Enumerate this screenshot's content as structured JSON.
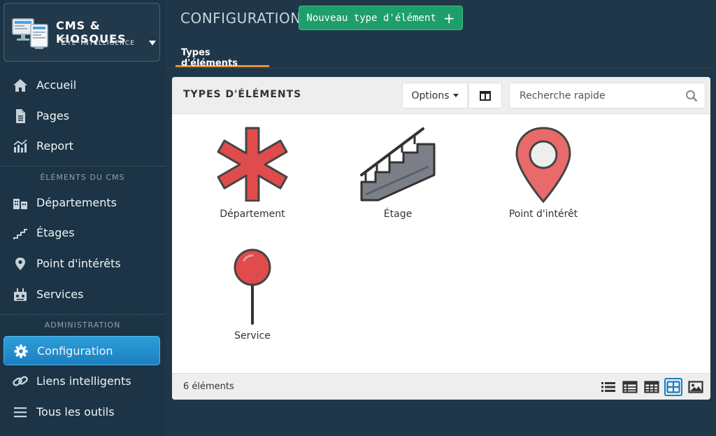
{
  "brand": {
    "title": "CMS & KIOSQUES",
    "subtitle": "Eye-Intelligence",
    "icon": "monitor-kiosk-icon"
  },
  "sidebar": {
    "items": [
      {
        "label": "Accueil",
        "icon": "home-icon"
      },
      {
        "label": "Pages",
        "icon": "file-icon"
      },
      {
        "label": "Report",
        "icon": "chart-icon"
      },
      {
        "label": "Départements",
        "icon": "departments-icon"
      },
      {
        "label": "Étages",
        "icon": "stairs-icon"
      },
      {
        "label": "Point d'intérêts",
        "icon": "map-pin-icon"
      },
      {
        "label": "Services",
        "icon": "services-icon"
      },
      {
        "label": "Configuration",
        "icon": "gear-icon",
        "active": true
      },
      {
        "label": "Liens intelligents",
        "icon": "link-icon"
      },
      {
        "label": "Tous les outils",
        "icon": "menu-icon"
      }
    ],
    "sections": [
      "ÉLÉMENTS DU CMS",
      "ADMINISTRATION"
    ]
  },
  "header": {
    "title": "CONFIGURATION",
    "new_button": "Nouveau type d'élément",
    "tab": "Types d'éléments"
  },
  "panel": {
    "title": "TYPES D'ÉLÉMENTS",
    "options_label": "Options",
    "search_placeholder": "Recherche rapide",
    "tiles": [
      {
        "label": "Département",
        "icon": "medical-star-icon"
      },
      {
        "label": "Étage",
        "icon": "staircase-icon"
      },
      {
        "label": "Point d'intérêt",
        "icon": "location-pin-icon"
      },
      {
        "label": "Service",
        "icon": "pushpin-icon"
      }
    ],
    "count": "6 éléments"
  },
  "colors": {
    "sidebar_bg": "#1c3445",
    "active": "#1b7fbf",
    "primary_button": "#1e9e6a",
    "accent_tab": "#e2923c",
    "icon_red": "#e04b4b"
  }
}
